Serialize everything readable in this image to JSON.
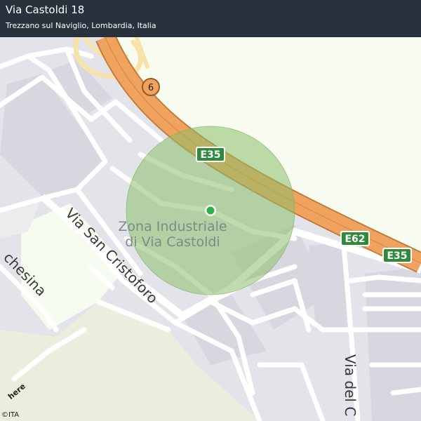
{
  "header": {
    "title": "Via Castoldi 18",
    "subtitle": "Trezzano sul Naviglio, Lombardia, Italia"
  },
  "map": {
    "area_label_line1": "Zona Industriale",
    "area_label_line2": "di Via Castoldi",
    "roads": {
      "san_cristoforo": "Via San Cristoforo",
      "chesina": "chesina",
      "via_del": "Via del C"
    },
    "shields": {
      "e35_top": "E35",
      "e62": "E62",
      "e35_right": "E35",
      "route6": "6"
    },
    "colors": {
      "radius_circle": "#8cc06a",
      "location_dot": "#2bb24c",
      "motorway": "#f0a35e",
      "shield_green": "#2e8b3d",
      "header_bg": "#27323d"
    }
  },
  "attribution": {
    "logo": "here",
    "copyright": "©ITA"
  }
}
